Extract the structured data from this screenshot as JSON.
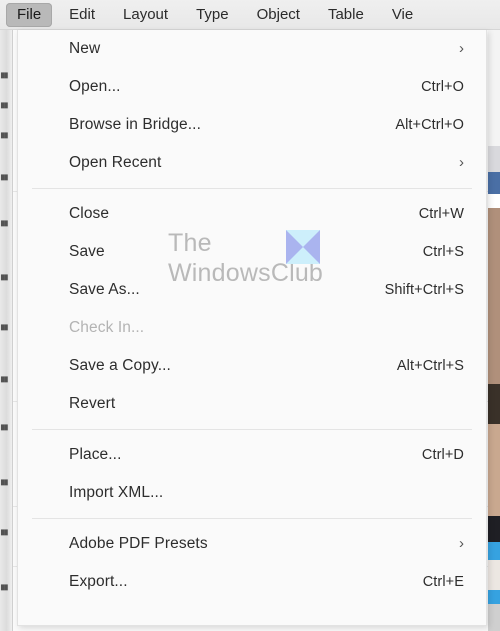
{
  "app": {
    "background_color": "#fafafa",
    "menubar_background": "#ebebeb",
    "accent_highlight": "#b9b9b9"
  },
  "menu_bar": {
    "items": [
      {
        "label": "File",
        "active": true,
        "clipped": false
      },
      {
        "label": "Edit",
        "active": false,
        "clipped": false
      },
      {
        "label": "Layout",
        "active": false,
        "clipped": false
      },
      {
        "label": "Type",
        "active": false,
        "clipped": false
      },
      {
        "label": "Object",
        "active": false,
        "clipped": false
      },
      {
        "label": "Table",
        "active": false,
        "clipped": false
      },
      {
        "label": "Vie",
        "active": false,
        "clipped": true
      }
    ]
  },
  "file_menu": {
    "groups": [
      {
        "items": [
          {
            "label": "New",
            "shortcut": "",
            "arrow": "›",
            "disabled": false
          },
          {
            "label": "Open...",
            "shortcut": "Ctrl+O",
            "arrow": "",
            "disabled": false
          },
          {
            "label": "Browse in Bridge...",
            "shortcut": "Alt+Ctrl+O",
            "arrow": "",
            "disabled": false
          },
          {
            "label": "Open Recent",
            "shortcut": "",
            "arrow": "›",
            "disabled": false
          }
        ]
      },
      {
        "items": [
          {
            "label": "Close",
            "shortcut": "Ctrl+W",
            "arrow": "",
            "disabled": false
          },
          {
            "label": "Save",
            "shortcut": "Ctrl+S",
            "arrow": "",
            "disabled": false
          },
          {
            "label": "Save As...",
            "shortcut": "Shift+Ctrl+S",
            "arrow": "",
            "disabled": false
          },
          {
            "label": "Check In...",
            "shortcut": "",
            "arrow": "",
            "disabled": true
          },
          {
            "label": "Save a Copy...",
            "shortcut": "Alt+Ctrl+S",
            "arrow": "",
            "disabled": false
          },
          {
            "label": "Revert",
            "shortcut": "",
            "arrow": "",
            "disabled": false
          }
        ]
      },
      {
        "items": [
          {
            "label": "Place...",
            "shortcut": "Ctrl+D",
            "arrow": "",
            "disabled": false
          },
          {
            "label": "Import XML...",
            "shortcut": "",
            "arrow": "",
            "disabled": false
          }
        ]
      },
      {
        "items": [
          {
            "label": "Adobe PDF Presets",
            "shortcut": "",
            "arrow": "›",
            "disabled": false
          },
          {
            "label": "Export...",
            "shortcut": "Ctrl+E",
            "arrow": "",
            "disabled": false
          }
        ]
      }
    ]
  },
  "watermark": {
    "line1": "The",
    "line2": "WindowsClub",
    "text_color": "#b9b9b9",
    "logo_color_light": "#cdeffb",
    "logo_color_dark": "#aab4ef"
  }
}
